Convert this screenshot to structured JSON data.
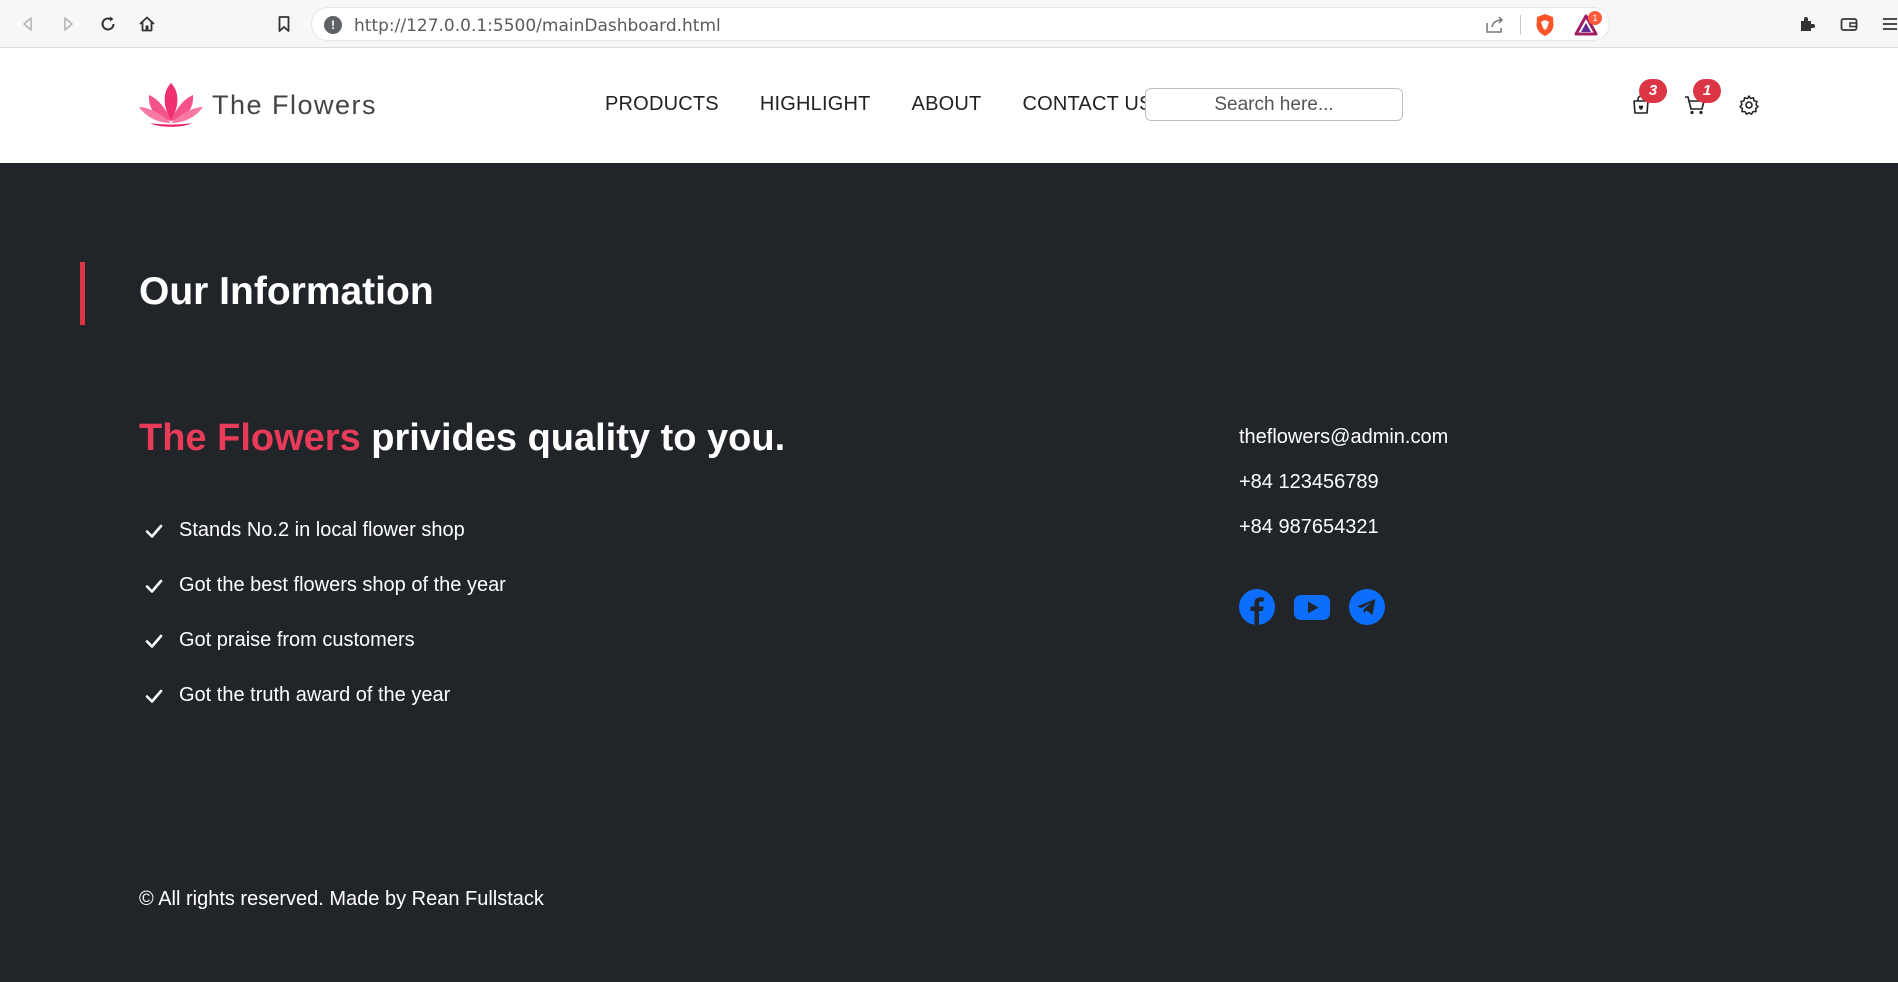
{
  "browser": {
    "url": "http://127.0.0.1:5500/mainDashboard.html",
    "bat_badge": "1"
  },
  "header": {
    "logo_text": "The Flowers",
    "nav": [
      "PRODUCTS",
      "HIGHLIGHT",
      "ABOUT",
      "CONTACT US"
    ],
    "search_placeholder": "Search here...",
    "bag_count": "3",
    "cart_count": "1"
  },
  "info": {
    "title": "Our Information",
    "tagline_brand": "The Flowers",
    "tagline_rest": " privides quality to you.",
    "features": [
      "Stands No.2 in local flower shop",
      "Got the best flowers shop of the year",
      "Got praise from customers",
      "Got the truth award of the year"
    ],
    "email": "theflowers@admin.com",
    "phone1": "+84 123456789",
    "phone2": "+84 987654321",
    "socials": [
      "facebook-icon",
      "youtube-icon",
      "telegram-icon"
    ],
    "copyright": "© All rights reserved. Made by Rean Fullstack"
  },
  "colors": {
    "accent": "#dc3545",
    "brand_pink": "#e83a59",
    "dark_bg": "#212529",
    "social_blue": "#0d6efd"
  }
}
